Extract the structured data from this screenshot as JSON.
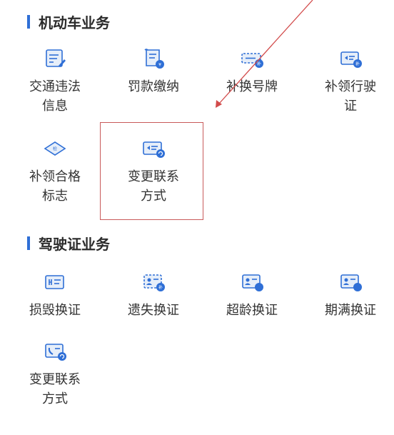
{
  "sections": [
    {
      "title": "机动车业务",
      "items": [
        {
          "label": "交通违法\n信息",
          "icon": "document-edit-icon"
        },
        {
          "label": "罚款缴纳",
          "icon": "bill-payment-icon"
        },
        {
          "label": "补换号牌",
          "icon": "license-plate-icon"
        },
        {
          "label": "补领行驶\n证",
          "icon": "vehicle-license-icon"
        },
        {
          "label": "补领合格\n标志",
          "icon": "inspection-sticker-icon"
        },
        {
          "label": "变更联系\n方式",
          "icon": "contact-change-card-icon"
        }
      ]
    },
    {
      "title": "驾驶证业务",
      "items": [
        {
          "label": "损毁换证",
          "icon": "damaged-license-icon"
        },
        {
          "label": "遗失换证",
          "icon": "lost-license-icon"
        },
        {
          "label": "超龄换证",
          "icon": "overage-license-icon"
        },
        {
          "label": "期满换证",
          "icon": "expired-license-icon"
        },
        {
          "label": "变更联系\n方式",
          "icon": "contact-change-phone-icon"
        }
      ]
    }
  ],
  "colors": {
    "accent": "#2f6fd6",
    "icon_fill": "#e6eef9",
    "annotation": "#d24b4b"
  }
}
